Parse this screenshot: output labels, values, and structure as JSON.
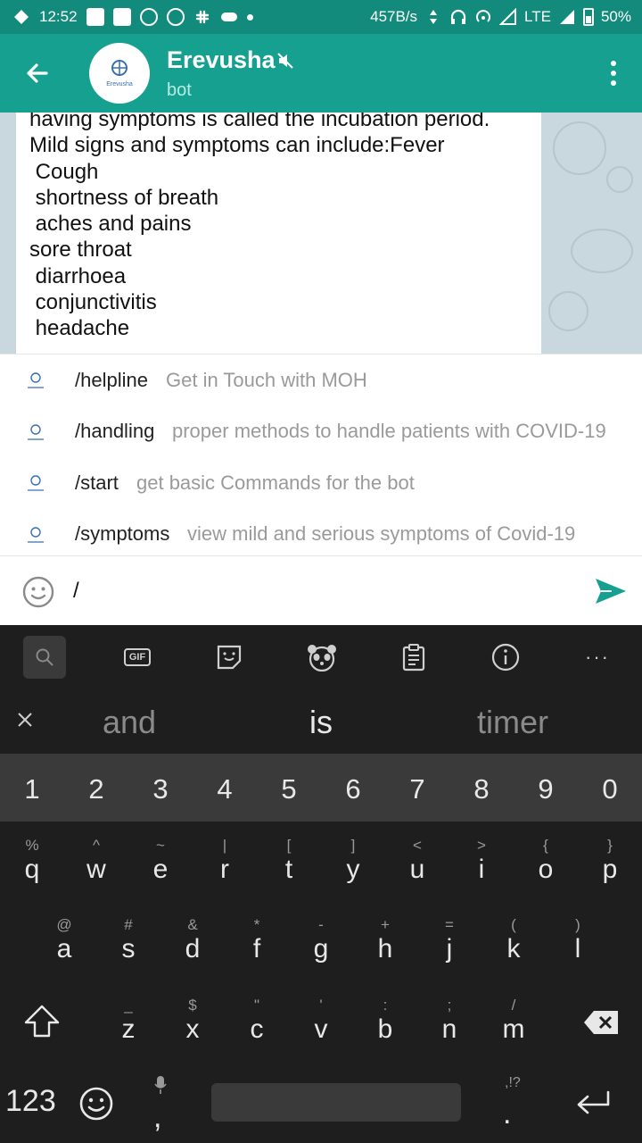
{
  "status_bar": {
    "time": "12:52",
    "net_speed": "457B/s",
    "network": "LTE",
    "battery": "50%"
  },
  "app_bar": {
    "title": "Erevusha",
    "subtitle": "bot",
    "avatar_text": "Erevusha"
  },
  "message": {
    "lines": [
      "having symptoms is called the incubation period.",
      "Mild signs and symptoms can include:Fever",
      " Cough",
      " shortness of breath",
      " aches and pains",
      "sore throat",
      " diarrhoea",
      " conjunctivitis",
      " headache"
    ]
  },
  "commands": [
    {
      "name": "/helpline",
      "description": "Get in Touch with MOH"
    },
    {
      "name": "/handling",
      "description": "proper methods to handle patients with COVID-19"
    },
    {
      "name": "/start",
      "description": "get basic Commands for the bot"
    },
    {
      "name": "/symptoms",
      "description": "view mild and serious symptoms of Covid-19"
    }
  ],
  "input": {
    "value": "/"
  },
  "keyboard": {
    "toolbar": {
      "gif_label": "GIF",
      "more": "···"
    },
    "suggestions": [
      "and",
      "is",
      "timer"
    ],
    "numbers": [
      "1",
      "2",
      "3",
      "4",
      "5",
      "6",
      "7",
      "8",
      "9",
      "0"
    ],
    "row1": [
      {
        "ch": "q",
        "hint": "%"
      },
      {
        "ch": "w",
        "hint": "^"
      },
      {
        "ch": "e",
        "hint": "~"
      },
      {
        "ch": "r",
        "hint": "|"
      },
      {
        "ch": "t",
        "hint": "["
      },
      {
        "ch": "y",
        "hint": "]"
      },
      {
        "ch": "u",
        "hint": "<"
      },
      {
        "ch": "i",
        "hint": ">"
      },
      {
        "ch": "o",
        "hint": "{"
      },
      {
        "ch": "p",
        "hint": "}"
      }
    ],
    "row2": [
      {
        "ch": "a",
        "hint": "@"
      },
      {
        "ch": "s",
        "hint": "#"
      },
      {
        "ch": "d",
        "hint": "&"
      },
      {
        "ch": "f",
        "hint": "*"
      },
      {
        "ch": "g",
        "hint": "-"
      },
      {
        "ch": "h",
        "hint": "+"
      },
      {
        "ch": "j",
        "hint": "="
      },
      {
        "ch": "k",
        "hint": "("
      },
      {
        "ch": "l",
        "hint": ")"
      }
    ],
    "row3": [
      {
        "ch": "z",
        "hint": "_"
      },
      {
        "ch": "x",
        "hint": "$"
      },
      {
        "ch": "c",
        "hint": "\""
      },
      {
        "ch": "v",
        "hint": "'"
      },
      {
        "ch": "b",
        "hint": ":"
      },
      {
        "ch": "n",
        "hint": ";"
      },
      {
        "ch": "m",
        "hint": "/"
      }
    ],
    "mode_key": "123",
    "comma": ",",
    "period": ".",
    "punct_hint": ",!?"
  },
  "colors": {
    "status_bar": "#128a7c",
    "app_bar": "#16a08f",
    "accent": "#16a08f",
    "chat_bg": "#c9d7de",
    "keyboard_bg": "#1e1e1e"
  }
}
